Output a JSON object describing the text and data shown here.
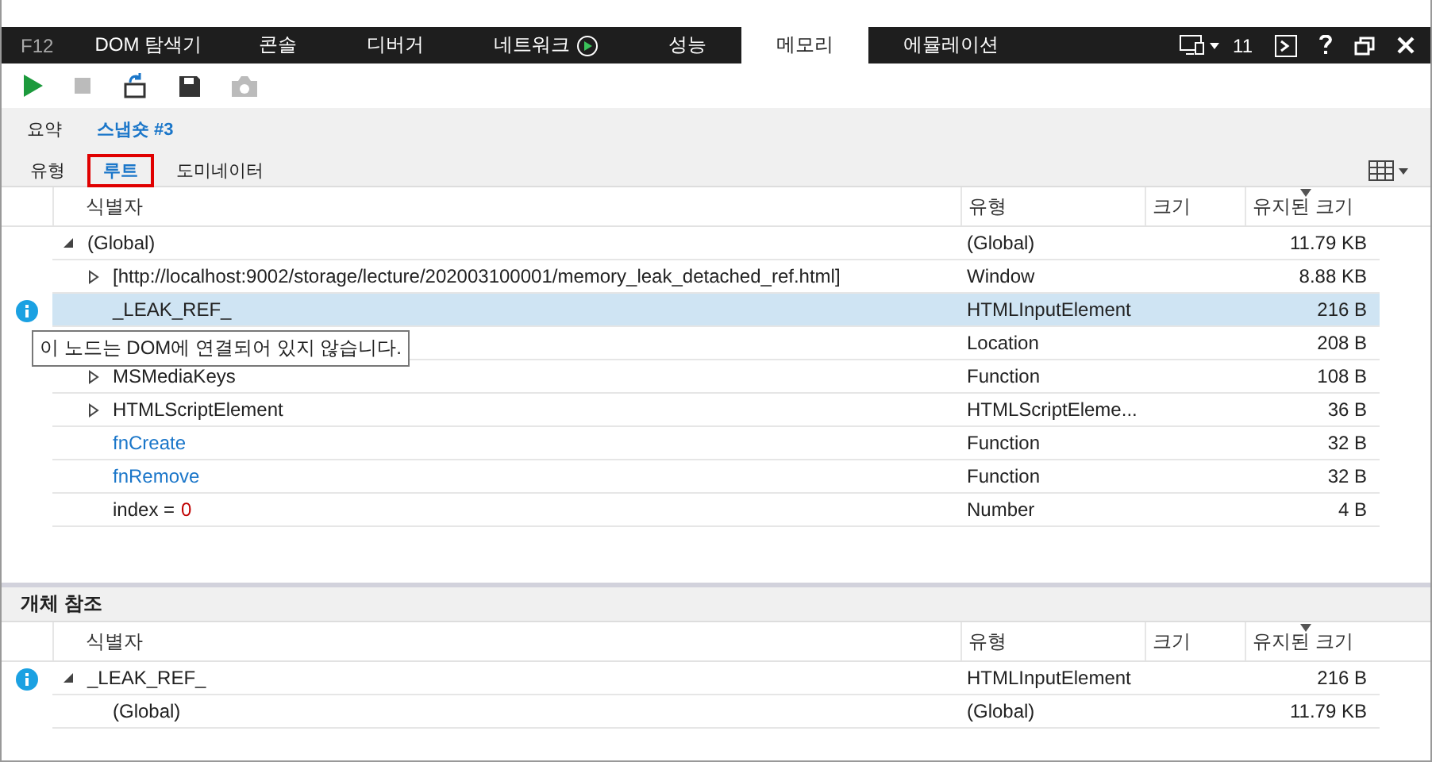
{
  "devtools": {
    "label": "F12",
    "tabs": [
      {
        "label": "DOM 탐색기",
        "selected": false
      },
      {
        "label": "콘솔",
        "selected": false
      },
      {
        "label": "디버거",
        "selected": false
      },
      {
        "label": "네트워크",
        "selected": false,
        "recording": true
      },
      {
        "label": "성능",
        "selected": false
      },
      {
        "label": "메모리",
        "selected": true
      },
      {
        "label": "에뮬레이션",
        "selected": false
      }
    ],
    "document_mode": "11"
  },
  "toolbar": [
    {
      "kind": "play",
      "disabled": false
    },
    {
      "kind": "stop",
      "disabled": true
    },
    {
      "kind": "import",
      "disabled": false
    },
    {
      "kind": "save",
      "disabled": false
    },
    {
      "kind": "camera",
      "disabled": true
    }
  ],
  "breadcrumb": {
    "summary": "요약",
    "snapshot": "스냅숏 #3"
  },
  "views": [
    {
      "label": "유형",
      "selected": false
    },
    {
      "label": "루트",
      "selected": true
    },
    {
      "label": "도미네이터",
      "selected": false
    }
  ],
  "table": {
    "columns": [
      {
        "label": "식별자",
        "sorted": false
      },
      {
        "label": "유형",
        "sorted": false
      },
      {
        "label": "크기",
        "sorted": false
      },
      {
        "label": "유지된 크기",
        "sorted": true
      }
    ],
    "rows": [
      {
        "identifier": "(Global)",
        "type": "(Global)",
        "retained": "11.79 KB",
        "expanded": true,
        "children": [
          {
            "identifier": "[http://localhost:9002/storage/lecture/202003100001/memory_leak_detached_ref.html]",
            "type": "Window",
            "retained": "8.88 KB",
            "expanded": false
          },
          {
            "identifier": "_LEAK_REF_",
            "type": "HTMLInputElement",
            "retained": "216 B",
            "selected": true,
            "info": true
          },
          {
            "type": "Location",
            "retained": "208 B"
          },
          {
            "identifier": "MSMediaKeys",
            "type": "Function",
            "retained": "108 B",
            "expanded": false
          },
          {
            "identifier": "HTMLScriptElement",
            "type": "HTMLScriptEleme...",
            "retained": "36 B",
            "expanded": false
          },
          {
            "identifier": "fnCreate",
            "kind": "function",
            "type": "Function",
            "retained": "32 B"
          },
          {
            "identifier": "fnRemove",
            "kind": "function",
            "type": "Function",
            "retained": "32 B"
          },
          {
            "identifier": "index =",
            "value": "0",
            "type": "Number",
            "retained": "4 B"
          }
        ]
      }
    ],
    "tooltip": "이 노드는 DOM에 연결되어 있지 않습니다."
  },
  "object_references": {
    "title": "개체 참조",
    "columns": [
      {
        "label": "식별자",
        "sorted": false
      },
      {
        "label": "유형",
        "sorted": false
      },
      {
        "label": "크기",
        "sorted": false
      },
      {
        "label": "유지된 크기",
        "sorted": true
      }
    ],
    "rows": [
      {
        "identifier": "_LEAK_REF_",
        "type": "HTMLInputElement",
        "retained": "216 B",
        "expanded": true,
        "info": true,
        "children": [
          {
            "identifier": "(Global)",
            "type": "(Global)",
            "retained": "11.79 KB"
          }
        ]
      }
    ]
  }
}
